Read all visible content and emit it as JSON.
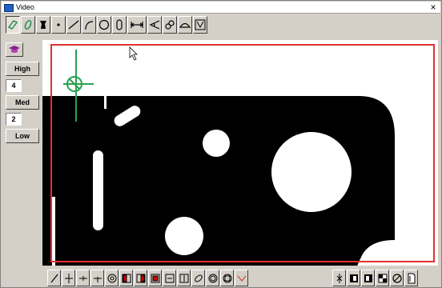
{
  "window": {
    "title": "Video",
    "close_symbol": "×"
  },
  "toolbar_top": [
    {
      "icon": "select-region-icon"
    },
    {
      "icon": "probe-icon"
    },
    {
      "icon": "edge-tool-icon"
    },
    {
      "icon": "point-icon"
    },
    {
      "icon": "line-icon"
    },
    {
      "icon": "arc-icon"
    },
    {
      "icon": "circle-icon"
    },
    {
      "icon": "slot-icon"
    },
    {
      "icon": "distance-icon"
    },
    {
      "icon": "angle-icon"
    },
    {
      "icon": "link-icon"
    },
    {
      "icon": "contour-icon"
    },
    {
      "icon": "auto-measure-icon"
    }
  ],
  "left_panel": {
    "graduation_icon": "graduation-cap-icon",
    "levels": [
      {
        "label": "High",
        "value": "4"
      },
      {
        "label": "Med",
        "value": "2"
      },
      {
        "label": "Low",
        "value": ""
      }
    ]
  },
  "video": {
    "part_color": "#000000",
    "roi_color": "#e53030",
    "crosshair_color": "#2aa050"
  },
  "toolbar_bottom": [
    {
      "icon": "pointer-icon"
    },
    {
      "icon": "cross-icon"
    },
    {
      "icon": "horizontal-cross-icon"
    },
    {
      "icon": "cross-hatch-icon"
    },
    {
      "icon": "circle-target-icon"
    },
    {
      "icon": "box-left-icon"
    },
    {
      "icon": "box-right-icon"
    },
    {
      "icon": "box-top-icon"
    },
    {
      "icon": "box-bottom-icon"
    },
    {
      "icon": "box-center-icon"
    },
    {
      "icon": "ellipse-icon"
    },
    {
      "icon": "double-circle-icon"
    },
    {
      "icon": "square-circle-icon"
    },
    {
      "icon": "check-icon"
    },
    {
      "icon": "vertical-split-icon"
    },
    {
      "icon": "focus-left-icon"
    },
    {
      "icon": "focus-right-icon"
    },
    {
      "icon": "checker-icon"
    },
    {
      "icon": "no-entry-icon"
    },
    {
      "icon": "page-icon"
    }
  ]
}
